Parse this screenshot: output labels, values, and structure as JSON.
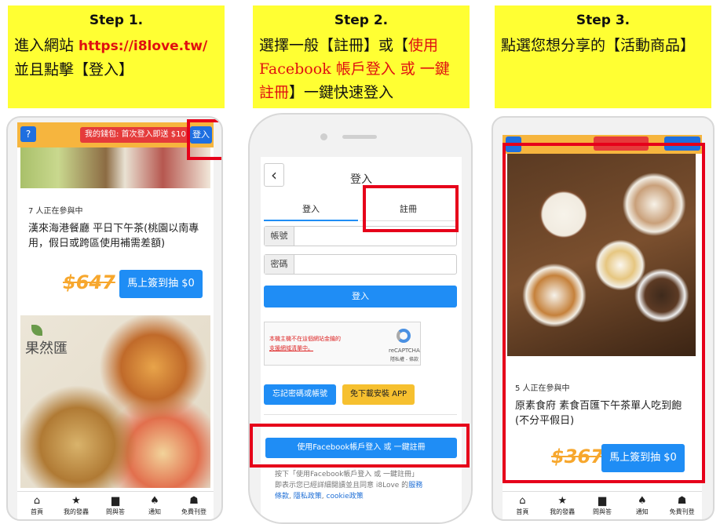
{
  "steps": [
    {
      "title": "Step 1.",
      "line1_pre": "進入網站 ",
      "line1_url": "https://i8love.tw/",
      "line2": "並且點擊【登入】"
    },
    {
      "title": "Step 2.",
      "l1_a": "選擇一般【註冊】或【",
      "l1_b": "使用",
      "l2": "Facebook 帳戶登入 或 一鍵",
      "l3_a": "註冊",
      "l3_b": "】一鍵快速登入"
    },
    {
      "title": "Step 3.",
      "line1": "點選您想分享的【活動商品】"
    }
  ],
  "phone1": {
    "help_icon": "?",
    "wallet": "我的錢包: 首次登入即送 $10",
    "login": "登入",
    "participants": "7 人正在參與中",
    "product": "漢來海港餐廳 平日下午茶(桃園以南專用，假日或跨區使用補需差額)",
    "price": "$647",
    "draw_btn": "馬上簽到抽 $0",
    "brand": "果然匯",
    "nav": [
      "首頁",
      "我的發轟",
      "問與答",
      "通知",
      "免費刊登"
    ]
  },
  "phone2": {
    "title": "登入",
    "back": "‹",
    "tab_login": "登入",
    "tab_register": "註冊",
    "account_label": "帳號",
    "password_label": "密碼",
    "login_btn": "登入",
    "captcha_l1": "本機主機不在這個網站金鑰的",
    "captcha_l2": "支援網域清單中。",
    "captcha_brand": "reCAPTCHA",
    "captcha_links": "隱私權 - 條款",
    "forgot_btn": "忘記密碼或帳號",
    "app_btn": "免下載安裝 APP",
    "fb_btn": "使用Facebook帳戶登入 或 一鍵註冊",
    "notice_l1": "按下「使用Facebook帳戶登入 或 一鍵註冊」",
    "notice_l2": "即表示您已經詳細閱讀並且同意 i8Love 的",
    "notice_link1": "服務",
    "notice_l3_link": "條款",
    "notice_sep": ", ",
    "notice_link2": "隱私政策",
    "notice_link3": "cookie政策"
  },
  "phone3": {
    "participants": "5 人正在參與中",
    "product": "原素食府 素食百匯下午茶單人吃到飽(不分平假日)",
    "price": "$367",
    "draw_btn": "馬上簽到抽 $0",
    "nav": [
      "首頁",
      "我的發轟",
      "問與答",
      "通知",
      "免費刊登"
    ]
  },
  "colors": {
    "yellow": "#ffff33",
    "red": "#e6001a",
    "blue": "#1f8df5",
    "orange": "#f6b53e"
  }
}
